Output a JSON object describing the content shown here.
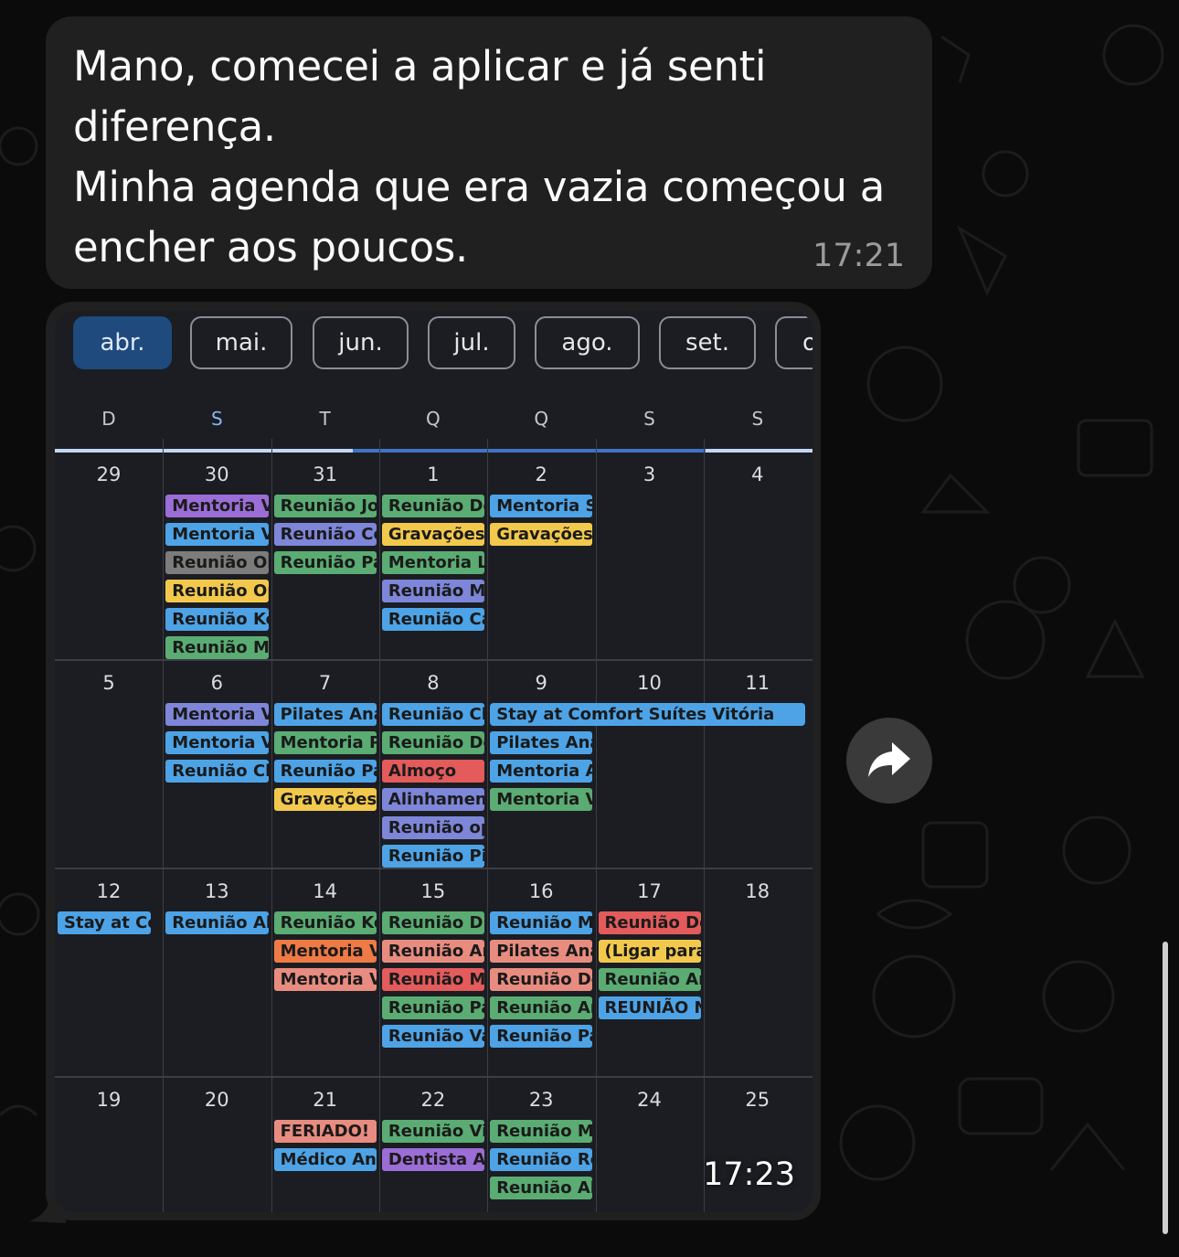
{
  "message_text": {
    "lines": [
      "Mano, comecei a aplicar e já senti",
      "diferença.",
      "Minha agenda que era vazia começou a",
      "encher aos poucos."
    ],
    "time": "17:21"
  },
  "image_message": {
    "time": "17:23"
  },
  "calendar": {
    "months": [
      "abr.",
      "mai.",
      "jun.",
      "jul.",
      "ago.",
      "set.",
      "o"
    ],
    "active_month": 0,
    "weekdays": [
      "D",
      "S",
      "T",
      "Q",
      "Q",
      "S",
      "S"
    ],
    "today_weekday": 1,
    "weeks": [
      {
        "days": [
          "29",
          "30",
          "31",
          "1",
          "2",
          "3",
          "4"
        ],
        "events": [
          {
            "day": 1,
            "row": 0,
            "label": "Mentoria V",
            "color": "#9b6dd6"
          },
          {
            "day": 1,
            "row": 1,
            "label": "Mentoria V",
            "color": "#4da3e6"
          },
          {
            "day": 1,
            "row": 2,
            "label": "Reunião Ol",
            "color": "#7c7c7c"
          },
          {
            "day": 1,
            "row": 3,
            "label": "Reunião Op",
            "color": "#f2c94c"
          },
          {
            "day": 1,
            "row": 4,
            "label": "Reunião Ke",
            "color": "#4da3e6"
          },
          {
            "day": 1,
            "row": 5,
            "label": "Reunião Ma",
            "color": "#5aac73"
          },
          {
            "day": 2,
            "row": 0,
            "label": "Reunião Jo",
            "color": "#5aac73"
          },
          {
            "day": 2,
            "row": 1,
            "label": "Reunião Co",
            "color": "#7d86d8"
          },
          {
            "day": 2,
            "row": 2,
            "label": "Reunião Pa",
            "color": "#5aac73"
          },
          {
            "day": 3,
            "row": 0,
            "label": "Reunião De",
            "color": "#5aac73"
          },
          {
            "day": 3,
            "row": 1,
            "label": "Gravações",
            "color": "#f2c94c"
          },
          {
            "day": 3,
            "row": 2,
            "label": "Mentoria L",
            "color": "#5aac73"
          },
          {
            "day": 3,
            "row": 3,
            "label": "Reunião Ma",
            "color": "#7d86d8"
          },
          {
            "day": 3,
            "row": 4,
            "label": "Reunião Ca",
            "color": "#4da3e6"
          },
          {
            "day": 4,
            "row": 0,
            "label": "Mentoria S",
            "color": "#4da3e6"
          },
          {
            "day": 4,
            "row": 1,
            "label": "Gravações",
            "color": "#f2c94c"
          }
        ]
      },
      {
        "days": [
          "5",
          "6",
          "7",
          "8",
          "9",
          "10",
          "11"
        ],
        "events": [
          {
            "day": 1,
            "row": 0,
            "label": "Mentoria V",
            "color": "#7d86d8"
          },
          {
            "day": 1,
            "row": 1,
            "label": "Mentoria V",
            "color": "#4da3e6"
          },
          {
            "day": 1,
            "row": 2,
            "label": "Reunião Cl",
            "color": "#4da3e6"
          },
          {
            "day": 2,
            "row": 0,
            "label": "Pilates Ana",
            "color": "#4da3e6"
          },
          {
            "day": 2,
            "row": 1,
            "label": "Mentoria P",
            "color": "#5aac73"
          },
          {
            "day": 2,
            "row": 2,
            "label": "Reunião Pa",
            "color": "#4da3e6"
          },
          {
            "day": 2,
            "row": 3,
            "label": "Gravações",
            "color": "#f2c94c"
          },
          {
            "day": 3,
            "row": 0,
            "label": "Reunião Cl",
            "color": "#4da3e6"
          },
          {
            "day": 3,
            "row": 1,
            "label": "Reunião De",
            "color": "#5aac73"
          },
          {
            "day": 3,
            "row": 2,
            "label": "Almoço",
            "color": "#e35b5b"
          },
          {
            "day": 3,
            "row": 3,
            "label": "Alinhamen",
            "color": "#7d86d8"
          },
          {
            "day": 3,
            "row": 4,
            "label": "Reunião op",
            "color": "#7d86d8"
          },
          {
            "day": 3,
            "row": 5,
            "label": "Reunião Pi",
            "color": "#4da3e6"
          },
          {
            "day": 4,
            "row": 0,
            "label": "Stay at Comfort Suítes Vitória",
            "color": "#4da3e6",
            "span": 3
          },
          {
            "day": 4,
            "row": 1,
            "label": "Pilates Ana",
            "color": "#4da3e6"
          },
          {
            "day": 4,
            "row": 2,
            "label": "Mentoria A",
            "color": "#4da3e6"
          },
          {
            "day": 4,
            "row": 3,
            "label": "Mentoria V",
            "color": "#5aac73"
          }
        ]
      },
      {
        "days": [
          "12",
          "13",
          "14",
          "15",
          "16",
          "17",
          "18"
        ],
        "events": [
          {
            "day": 0,
            "row": 0,
            "label": "Stay at Co",
            "color": "#4da3e6",
            "end_cap": true
          },
          {
            "day": 1,
            "row": 0,
            "label": "Reunião Al",
            "color": "#4da3e6"
          },
          {
            "day": 2,
            "row": 0,
            "label": "Reunião Ke",
            "color": "#5aac73"
          },
          {
            "day": 2,
            "row": 1,
            "label": "Mentoria V",
            "color": "#ee7a45"
          },
          {
            "day": 2,
            "row": 2,
            "label": "Mentoria V",
            "color": "#e88c80"
          },
          {
            "day": 3,
            "row": 0,
            "label": "Reunião Dr",
            "color": "#5aac73"
          },
          {
            "day": 3,
            "row": 1,
            "label": "Reunião Ar",
            "color": "#e88c80"
          },
          {
            "day": 3,
            "row": 2,
            "label": "Reunião Ma",
            "color": "#e35b5b"
          },
          {
            "day": 3,
            "row": 3,
            "label": "Reunião Pa",
            "color": "#5aac73"
          },
          {
            "day": 3,
            "row": 4,
            "label": "Reunião Va",
            "color": "#4da3e6"
          },
          {
            "day": 4,
            "row": 0,
            "label": "Reunião Mi",
            "color": "#4da3e6"
          },
          {
            "day": 4,
            "row": 1,
            "label": "Pilates Ana",
            "color": "#e88c80"
          },
          {
            "day": 4,
            "row": 2,
            "label": "Reunião De",
            "color": "#e88c80"
          },
          {
            "day": 4,
            "row": 3,
            "label": "Reunião Ar",
            "color": "#5aac73"
          },
          {
            "day": 4,
            "row": 4,
            "label": "Reunião Pa",
            "color": "#4da3e6"
          },
          {
            "day": 5,
            "row": 0,
            "label": "Reunião De",
            "color": "#e35b5b"
          },
          {
            "day": 5,
            "row": 1,
            "label": "(Ligar para",
            "color": "#f2c94c"
          },
          {
            "day": 5,
            "row": 2,
            "label": "Reunião Ar",
            "color": "#5aac73"
          },
          {
            "day": 5,
            "row": 3,
            "label": "REUNIÃO N",
            "color": "#4da3e6"
          }
        ]
      },
      {
        "days": [
          "19",
          "20",
          "21",
          "22",
          "23",
          "24",
          "25"
        ],
        "events": [
          {
            "day": 2,
            "row": 0,
            "label": "FERIADO!",
            "color": "#e88c80"
          },
          {
            "day": 2,
            "row": 1,
            "label": "Médico An",
            "color": "#4da3e6"
          },
          {
            "day": 3,
            "row": 0,
            "label": "Reunião Vi",
            "color": "#5aac73"
          },
          {
            "day": 3,
            "row": 1,
            "label": "Dentista A",
            "color": "#9b6dd6"
          },
          {
            "day": 4,
            "row": 0,
            "label": "Reunião Mi",
            "color": "#5aac73"
          },
          {
            "day": 4,
            "row": 1,
            "label": "Reunião Re",
            "color": "#4da3e6"
          },
          {
            "day": 4,
            "row": 2,
            "label": "Reunião Al",
            "color": "#5aac73"
          }
        ]
      }
    ]
  },
  "icons": {
    "forward": "forward-arrow-icon",
    "wallpaper": "doodle-pattern"
  }
}
